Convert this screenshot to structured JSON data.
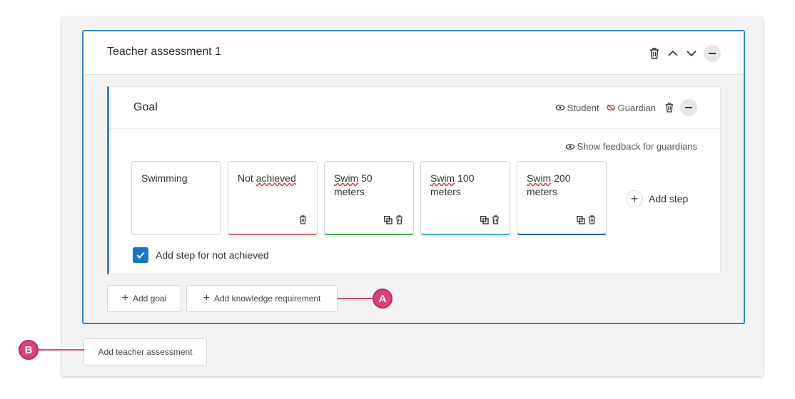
{
  "assessment": {
    "title": "Teacher assessment 1",
    "goal": {
      "title": "Goal",
      "visibility_student": "Student",
      "visibility_guardian": "Guardian",
      "show_feedback_label": "Show feedback for guardians",
      "steps": [
        {
          "text": "Swimming",
          "accent": "#d0d0d0"
        },
        {
          "text_plain": "Not ",
          "text_underlined": "achieved",
          "accent": "#e06b73"
        },
        {
          "text_underlined": "Swim",
          "text_plain": " 50 meters",
          "accent": "#3fb54a"
        },
        {
          "text_underlined": "Swim",
          "text_plain": " 100 meters",
          "accent": "#37b3c4"
        },
        {
          "text_underlined": "Swim",
          "text_plain": " 200 meters",
          "accent": "#1f5fae"
        }
      ],
      "add_step_label": "Add step",
      "not_achieved_checkbox_label": "Add step for not achieved"
    },
    "add_goal_label": "Add goal",
    "add_knowledge_label": "Add knowledge requirement"
  },
  "add_teacher_assessment_label": "Add teacher assessment",
  "callouts": {
    "a": "A",
    "b": "B"
  },
  "colors": {
    "accent": "#2f86d6",
    "callout": "#e0417a",
    "checkbox": "#1a73c8"
  }
}
